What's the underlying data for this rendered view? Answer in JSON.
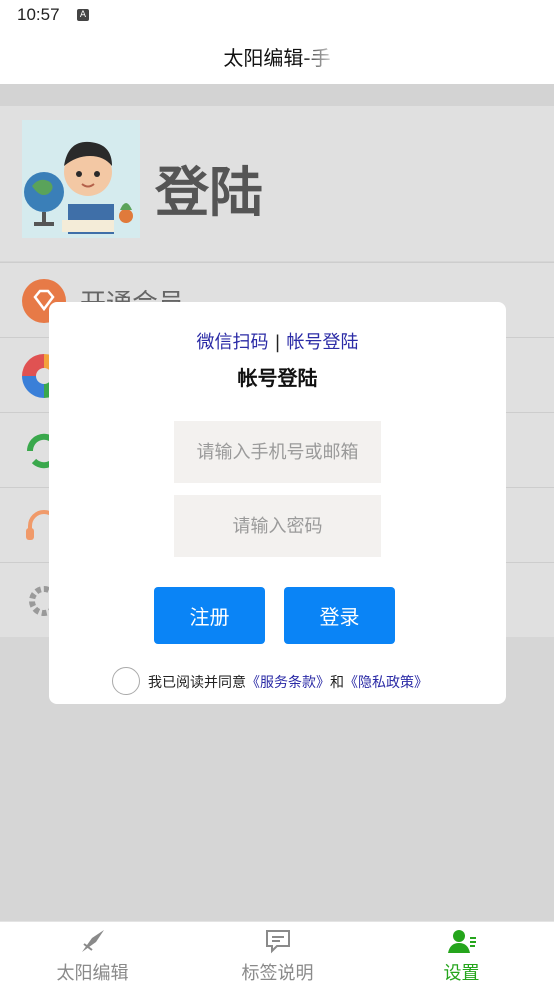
{
  "status": {
    "time": "10:57",
    "notif_icon": "a-notification-icon"
  },
  "header": {
    "title": "太阳编辑-手"
  },
  "profile": {
    "login_label": "登陆",
    "avatar_icon": "boy-with-globe-illustration"
  },
  "menu": {
    "items": [
      {
        "label": "开通会员",
        "icon": "diamond-icon",
        "color": "#e77a47"
      },
      {
        "label": "",
        "icon": "aperture-icon",
        "color": "#f3a33b"
      },
      {
        "label": "",
        "icon": "sync-icon",
        "color": "#3aa84c"
      },
      {
        "label": "",
        "icon": "headset-icon",
        "color": "#f09a6a"
      },
      {
        "label": "",
        "icon": "gear-icon",
        "color": "#9a9a9a"
      }
    ]
  },
  "dialog": {
    "wechat_link": "微信扫码",
    "separator": "|",
    "account_link": "帐号登陆",
    "title": "帐号登陆",
    "phone_placeholder": "请输入手机号或邮箱",
    "password_placeholder": "请输入密码",
    "register_label": "注册",
    "login_label": "登录",
    "agree_prefix": "我已阅读并同意",
    "terms_link": "《服务条款》",
    "and_text": "和",
    "privacy_link": "《隐私政策》"
  },
  "tabs": [
    {
      "label": "太阳编辑",
      "icon": "pen-nib-icon",
      "active": false
    },
    {
      "label": "标签说明",
      "icon": "chat-bubble-icon",
      "active": false
    },
    {
      "label": "设置",
      "icon": "user-settings-icon",
      "active": true
    }
  ],
  "colors": {
    "primary": "#0a84f6",
    "active_tab": "#25a51c",
    "link": "#2b2ba6",
    "overlay_bg": "#d6d6d6"
  }
}
